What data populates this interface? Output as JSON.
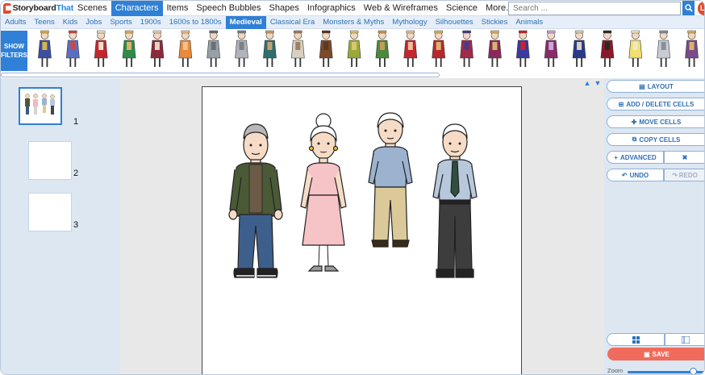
{
  "app": {
    "logo_text_a": "Storyboard",
    "logo_text_b": "That"
  },
  "topnav": {
    "items": [
      {
        "label": "Scenes",
        "active": false
      },
      {
        "label": "Characters",
        "active": true
      },
      {
        "label": "Items",
        "active": false
      },
      {
        "label": "Speech Bubbles",
        "active": false
      },
      {
        "label": "Shapes",
        "active": false
      },
      {
        "label": "Infographics",
        "active": false
      },
      {
        "label": "Web & Wireframes",
        "active": false
      },
      {
        "label": "Science",
        "active": false
      },
      {
        "label": "More...",
        "active": false
      }
    ],
    "search_placeholder": "Search ...",
    "user_initial": "L"
  },
  "categories": [
    {
      "label": "Adults",
      "active": false
    },
    {
      "label": "Teens",
      "active": false
    },
    {
      "label": "Kids",
      "active": false
    },
    {
      "label": "Jobs",
      "active": false
    },
    {
      "label": "Sports",
      "active": false
    },
    {
      "label": "1900s",
      "active": false
    },
    {
      "label": "1600s to 1800s",
      "active": false
    },
    {
      "label": "Medieval",
      "active": true
    },
    {
      "label": "Classical Era",
      "active": false
    },
    {
      "label": "Monsters & Myths",
      "active": false
    },
    {
      "label": "Mythology",
      "active": false
    },
    {
      "label": "Silhouettes",
      "active": false
    },
    {
      "label": "Stickies",
      "active": false
    },
    {
      "label": "Animals",
      "active": false
    }
  ],
  "strip": {
    "show_filters_line1": "SHOW",
    "show_filters_line2": "FILTERS",
    "characters": [
      {
        "body": "#3a4fa0",
        "accent": "#d6b44a"
      },
      {
        "body": "#5a6fc2",
        "accent": "#c94a4a"
      },
      {
        "body": "#c4262e",
        "accent": "#e8e0d0"
      },
      {
        "body": "#2e8b4a",
        "accent": "#d8b46a"
      },
      {
        "body": "#8b2a3a",
        "accent": "#e6d3c0"
      },
      {
        "body": "#e88a3a",
        "accent": "#f0c090"
      },
      {
        "body": "#9aa0a8",
        "accent": "#6a7078"
      },
      {
        "body": "#b0b4ba",
        "accent": "#7a8088"
      },
      {
        "body": "#2f6e6e",
        "accent": "#c8a070"
      },
      {
        "body": "#d8d0c0",
        "accent": "#a08060"
      },
      {
        "body": "#7a4a2a",
        "accent": "#5a3a20"
      },
      {
        "body": "#9aaa3a",
        "accent": "#d8c870"
      },
      {
        "body": "#4a8a3a",
        "accent": "#c89a5a"
      },
      {
        "body": "#c4262e",
        "accent": "#e8c0a0"
      },
      {
        "body": "#b8262e",
        "accent": "#d8b46a"
      },
      {
        "body": "#a02a4a",
        "accent": "#4a3a8a"
      },
      {
        "body": "#8a2a5a",
        "accent": "#d8b46a"
      },
      {
        "body": "#3a3aa0",
        "accent": "#c4262e"
      },
      {
        "body": "#8a2a6a",
        "accent": "#c8a8d8"
      },
      {
        "body": "#2a3a8a",
        "accent": "#d8d0c0"
      },
      {
        "body": "#8a1a2a",
        "accent": "#2a2a2a"
      },
      {
        "body": "#f0e070",
        "accent": "#f0e8c8"
      },
      {
        "body": "#c8ccd4",
        "accent": "#8a909a"
      },
      {
        "body": "#7a4a8a",
        "accent": "#d8b46a"
      }
    ]
  },
  "cells": [
    {
      "number": "1",
      "selected": true
    },
    {
      "number": "2",
      "selected": false
    },
    {
      "number": "3",
      "selected": false
    }
  ],
  "actions": {
    "layout": "LAYOUT",
    "add_delete_cells": "ADD / DELETE CELLS",
    "move_cells": "MOVE CELLS",
    "copy_cells": "COPY CELLS",
    "advanced": "ADVANCED",
    "undo": "UNDO",
    "redo": "REDO",
    "save": "SAVE",
    "zoom_label": "Zoom"
  },
  "zoom_level": 0.85,
  "colors": {
    "accent": "#2f80d6",
    "save": "#f06b5b",
    "panel": "#dde7f2"
  }
}
